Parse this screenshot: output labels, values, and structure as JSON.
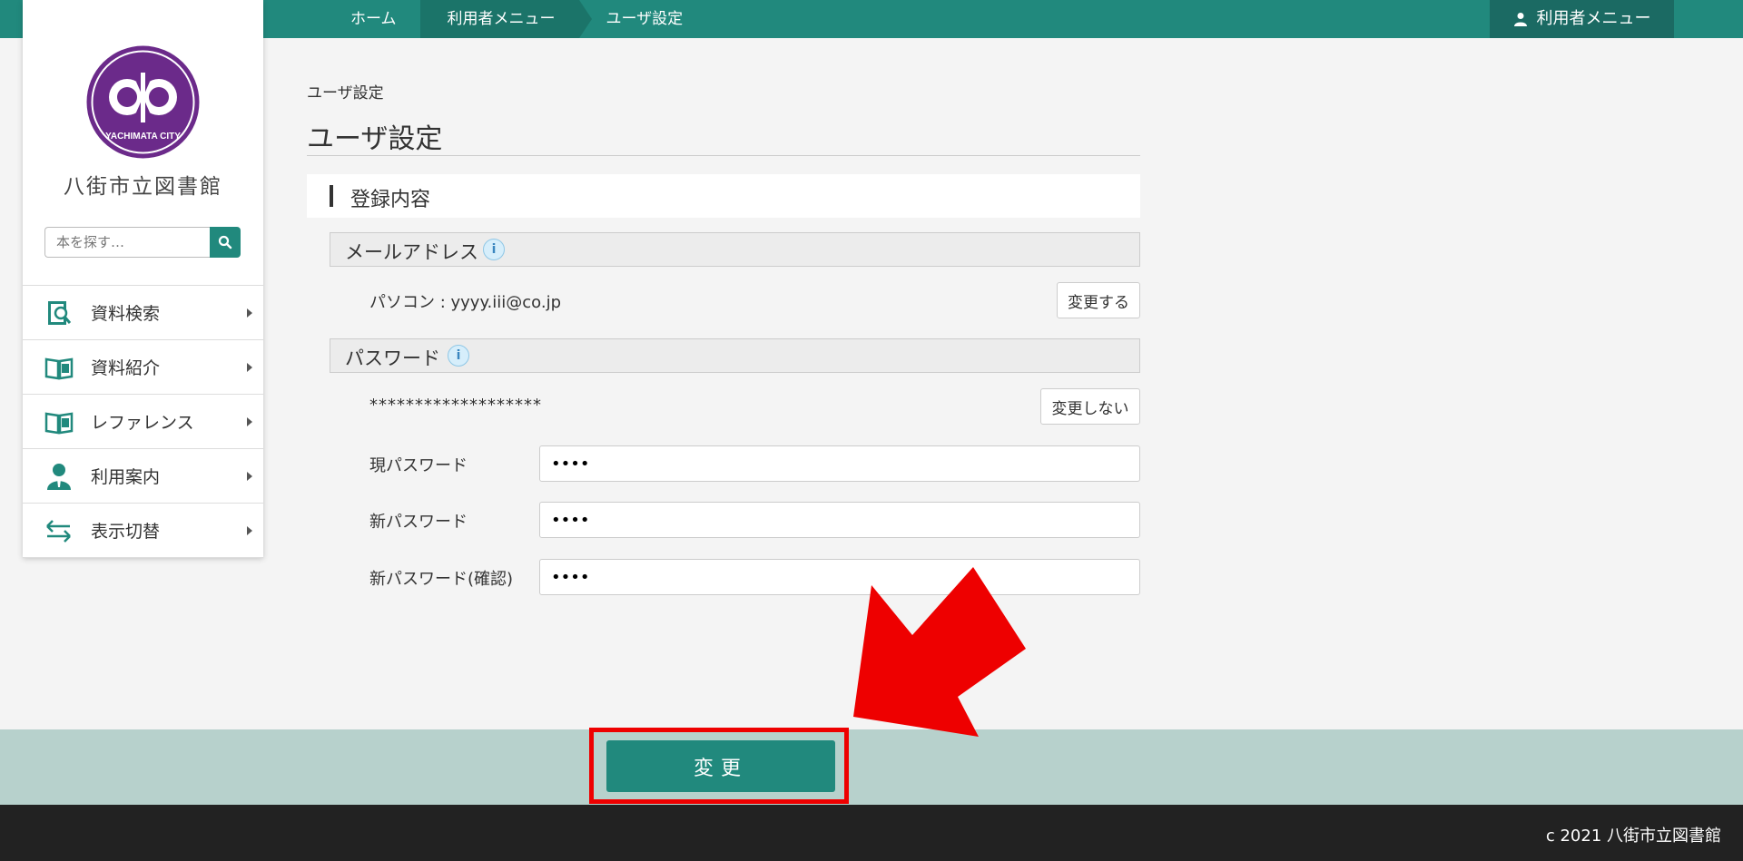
{
  "breadcrumb": [
    "ホーム",
    "利用者メニュー",
    "ユーザ設定"
  ],
  "header": {
    "user_menu_label": "利用者メニュー"
  },
  "sidebar": {
    "library_name": "八街市立図書館",
    "logo_text": "YACHIMATA CITY",
    "search_placeholder": "本を探す…",
    "items": [
      {
        "label": "資料検索",
        "icon": "book-search-icon"
      },
      {
        "label": "資料紹介",
        "icon": "open-book-icon"
      },
      {
        "label": "レファレンス",
        "icon": "open-book-icon"
      },
      {
        "label": "利用案内",
        "icon": "person-icon"
      },
      {
        "label": "表示切替",
        "icon": "swap-arrows-icon"
      }
    ]
  },
  "main": {
    "small_title": "ユーザ設定",
    "page_title": "ユーザ設定",
    "section_title": "登録内容",
    "email": {
      "label": "メールアドレス",
      "value": "パソコン : yyyy.iii@co.jp",
      "change_button": "変更する"
    },
    "password": {
      "label": "パスワード",
      "masked": "*******************",
      "toggle_button": "変更しない",
      "current_label": "現パスワード",
      "current_value": "••••",
      "new_label": "新パスワード",
      "new_value": "••••",
      "confirm_label": "新パスワード(確認)",
      "confirm_value": "••••"
    },
    "submit_label": "変更"
  },
  "footer": {
    "copyright": "c 2021 八街市立図書館"
  },
  "colors": {
    "accent": "#21897d",
    "highlight": "#ee0000",
    "band": "#b7d1cc"
  }
}
